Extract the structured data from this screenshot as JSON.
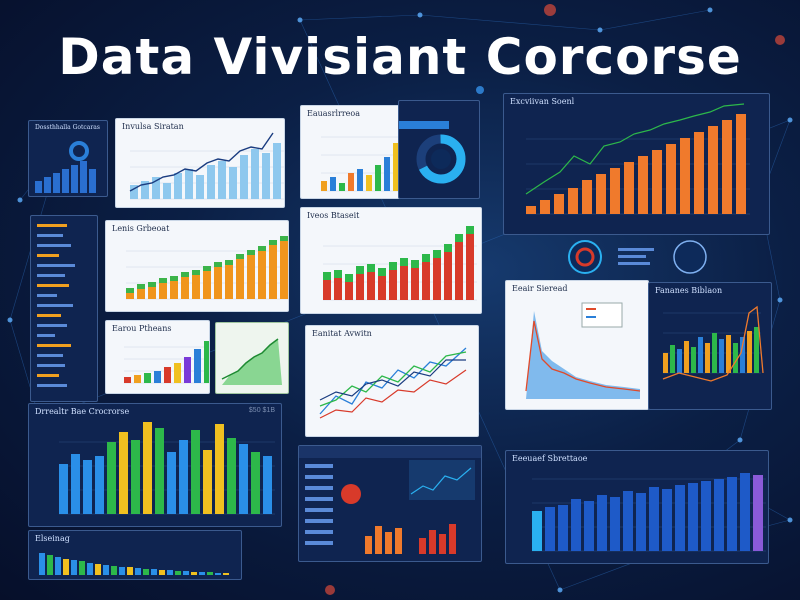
{
  "header": {
    "title": "Data Vivisiant Corcorse"
  },
  "colors": {
    "background": "#0b1f45",
    "orange": "#f07a2c",
    "green": "#2db84a",
    "blue": "#2a7fd8",
    "yellow": "#f0c020",
    "red": "#d83a2a"
  },
  "panels": {
    "p1": {
      "title": "Dossthhalla Gotcaras"
    },
    "p2": {
      "title": "Invulsa Siratan"
    },
    "p3": {
      "title": "Eauasrlrreoa"
    },
    "p5": {
      "title": "Excviivan Soenl"
    },
    "p7": {
      "title": "Lenis Grbeoat"
    },
    "p8": {
      "title": "Iveos Btaseit"
    },
    "p9": {
      "title": "Earou Ptheans"
    },
    "p11": {
      "title": "Eanitat Avwitn"
    },
    "p12": {
      "title": "Eeair Sieread"
    },
    "p13": {
      "title": "Fananes Biblaon"
    },
    "p14": {
      "title": "Drrealtr Bae Crocrorse",
      "value": "$50 $1B"
    },
    "p16": {
      "title": "Eeeuaef Sbrettaoe"
    },
    "p17": {
      "title": "Elseinag"
    }
  }
}
